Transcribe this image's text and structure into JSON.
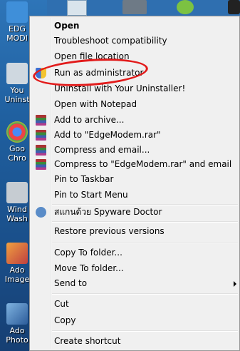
{
  "desktop": {
    "icons": [
      {
        "label": "EDGE MODEM",
        "name": "edge-modem-desktop-icon"
      },
      {
        "label": "Your Uninstaller",
        "name": "your-uninstaller-desktop-icon"
      },
      {
        "label": "Google Chrome",
        "name": "google-chrome-desktop-icon"
      },
      {
        "label": "Windows Washer",
        "name": "windows-washer-desktop-icon"
      },
      {
        "label": "Adobe ImageReady",
        "name": "adobe-imageready-desktop-icon"
      },
      {
        "label": "Adobe Photoshop",
        "name": "adobe-photoshop-desktop-icon"
      }
    ],
    "captions_visible": [
      "EDG\nMODI",
      "You\nUninst",
      "Goo\nChro",
      "Wind\nWash",
      "Ado\nImage",
      "Ado\nPhoto"
    ]
  },
  "menu": {
    "items": [
      {
        "label": "Open"
      },
      {
        "label": "Troubleshoot compatibility"
      },
      {
        "label": "Open file location"
      },
      {
        "label": "Run as administrator"
      },
      {
        "label": "Uninstall with Your Uninstaller!"
      },
      {
        "label": "Open with Notepad"
      },
      {
        "label": "Add to archive..."
      },
      {
        "label": "Add to \"EdgeModem.rar\""
      },
      {
        "label": "Compress and email..."
      },
      {
        "label": "Compress to \"EdgeModem.rar\" and email"
      },
      {
        "label": "Pin to Taskbar"
      },
      {
        "label": "Pin to Start Menu"
      },
      {
        "label": "สแกนด้วย Spyware Doctor"
      },
      {
        "label": "Restore previous versions"
      },
      {
        "label": "Copy To folder..."
      },
      {
        "label": "Move To folder..."
      },
      {
        "label": "Send to"
      },
      {
        "label": "Cut"
      },
      {
        "label": "Copy"
      },
      {
        "label": "Create shortcut"
      }
    ]
  },
  "annotation": {
    "color": "#e21b1b"
  }
}
